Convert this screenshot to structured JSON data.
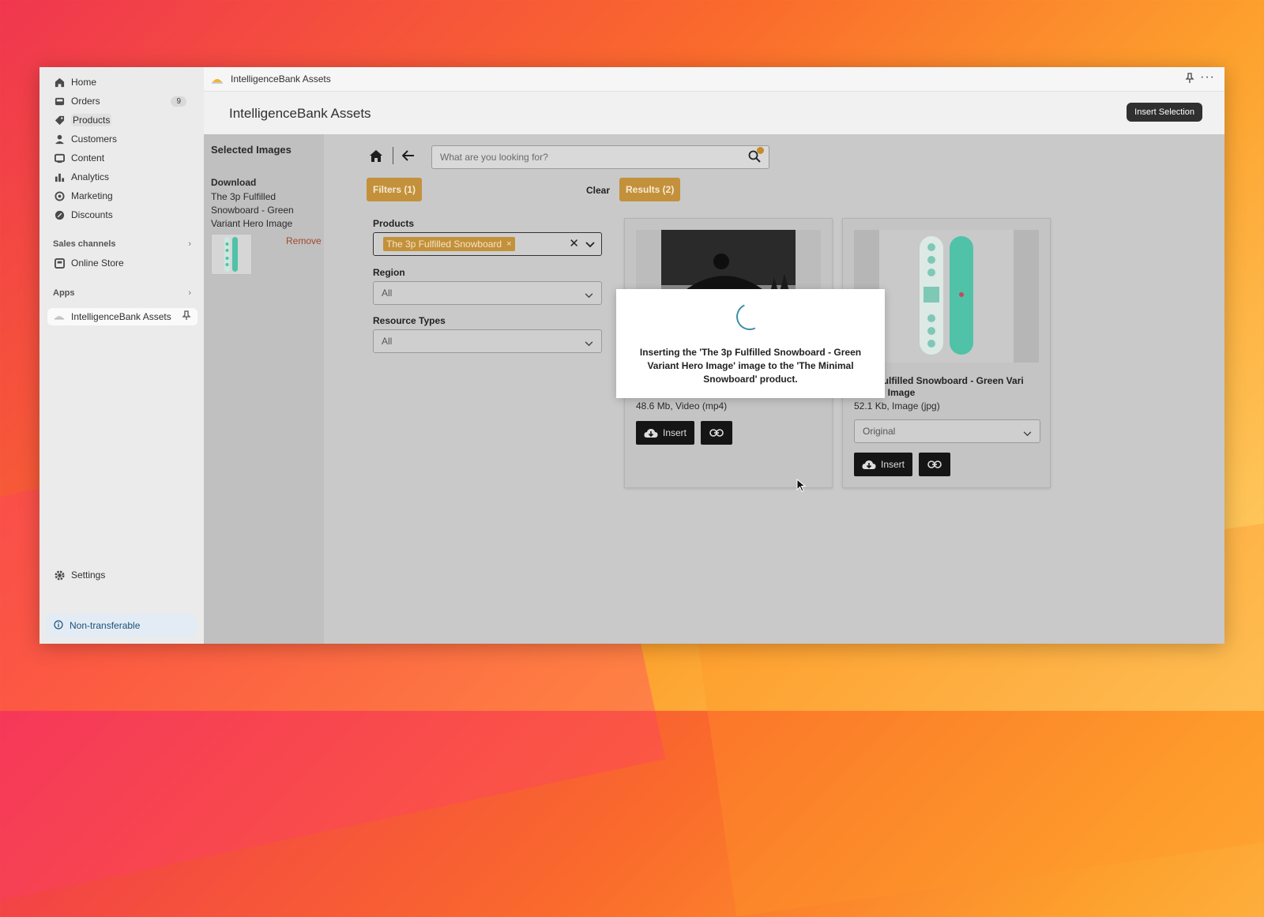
{
  "sidebar": {
    "nav": [
      {
        "label": "Home",
        "icon": "home-icon"
      },
      {
        "label": "Orders",
        "icon": "inbox-icon",
        "badge": "9"
      },
      {
        "label": "Products",
        "icon": "tag-icon"
      },
      {
        "label": "Customers",
        "icon": "person-icon"
      },
      {
        "label": "Content",
        "icon": "content-icon"
      },
      {
        "label": "Analytics",
        "icon": "bar-chart-icon"
      },
      {
        "label": "Marketing",
        "icon": "target-icon"
      },
      {
        "label": "Discounts",
        "icon": "discount-icon"
      }
    ],
    "sales_channels_label": "Sales channels",
    "online_store_label": "Online Store",
    "apps_label": "Apps",
    "app_label": "IntelligenceBank Assets",
    "settings_label": "Settings",
    "non_transferable_label": "Non-transferable",
    "chevron": "›"
  },
  "topbar": {
    "app_name": "IntelligenceBank Assets",
    "more": "···"
  },
  "header": {
    "title": "IntelligenceBank Assets",
    "insert_selection_label": "Insert Selection"
  },
  "selected_panel": {
    "title": "Selected Images",
    "download_label": "Download",
    "image_name": "The 3p Fulfilled Snowboard - Green Variant Hero Image",
    "remove_label": "Remove"
  },
  "search": {
    "placeholder": "What are you looking for?"
  },
  "filters": {
    "filters_label": "Filters (1)",
    "clear_label": "Clear",
    "results_label": "Results (2)",
    "products_label": "Products",
    "products_chip": "The 3p Fulfilled Snowboard",
    "chip_remove": "×",
    "clear_x": "✕",
    "region_label": "Region",
    "region_value": "All",
    "resource_types_label": "Resource Types",
    "resource_types_value": "All"
  },
  "results": [
    {
      "meta": "48.6 Mb, Video (mp4)",
      "insert_label": "Insert"
    },
    {
      "title": "The 3p Fulfilled Snowboard - Green Variant Hero Image",
      "title_visible": "3p Fulfilled Snowboard - Green Vari\nHero Image",
      "meta": "52.1 Kb, Image (jpg)",
      "variant_value": "Original",
      "insert_label": "Insert"
    }
  ],
  "modal": {
    "message": "Inserting the 'The 3p Fulfilled Snowboard - Green Variant Hero Image' image to the 'The Minimal Snowboard' product."
  },
  "colors": {
    "accent_amber": "#c3913b",
    "spinner": "#3c8ea3",
    "remove": "#a3482e",
    "snowboard_teal": "#4fc2a8"
  }
}
